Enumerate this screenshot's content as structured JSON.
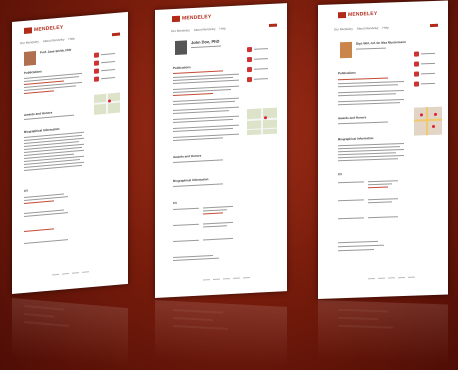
{
  "scene": {
    "background": "#7a1d0c",
    "accent": "#b12a1a"
  },
  "pages": [
    {
      "logo": "MENDELEY",
      "name": "Prof. Jane Smith, PhD",
      "nav": [
        "Our Mendeley",
        "About Mendeley",
        "Help"
      ],
      "sections": [
        "Publications",
        "Awards and Honors",
        "Biographical Information",
        "CV"
      ]
    },
    {
      "logo": "MENDELEY",
      "name": "John Doe, PhD",
      "nav": [
        "Our Mendeley",
        "About Mendeley",
        "Help"
      ],
      "sections": [
        "Publications",
        "Awards and Honors",
        "Biographical Information",
        "CV"
      ]
    },
    {
      "logo": "MENDELEY",
      "name": "Dipl.-Wirt.-Inf. Dr. Max Mustermann",
      "nav": [
        "Our Mendeley",
        "About Mendeley",
        "Help"
      ],
      "sections": [
        "Publications",
        "Awards and Honors",
        "Biographical Information",
        "CV"
      ]
    }
  ],
  "icons": [
    "mendeley-logo-icon",
    "avatar-photo",
    "map-image",
    "contact-avatar-icon"
  ]
}
